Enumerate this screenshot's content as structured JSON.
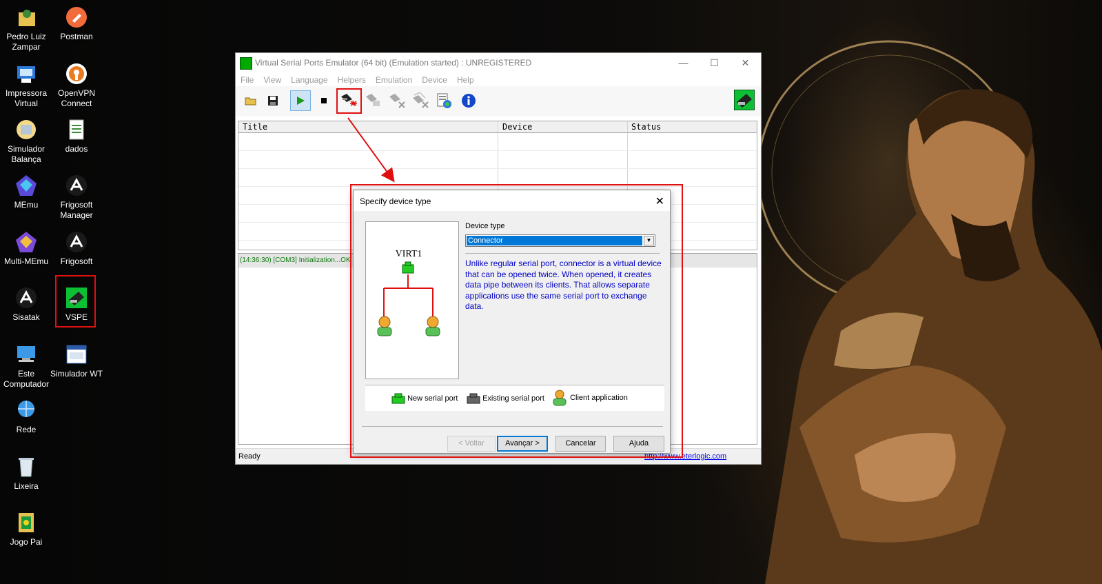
{
  "desktop": {
    "icons": [
      {
        "label": "Pedro Luiz Zampar",
        "icon": "user-folder-icon"
      },
      {
        "label": "Postman",
        "icon": "postman-icon"
      },
      {
        "label": "Impressora Virtual",
        "icon": "printer-icon"
      },
      {
        "label": "OpenVPN Connect",
        "icon": "openvpn-icon"
      },
      {
        "label": "Simulador Balança",
        "icon": "scale-simulator-icon"
      },
      {
        "label": "dados",
        "icon": "spreadsheet-file-icon"
      },
      {
        "label": "MEmu",
        "icon": "memu-icon"
      },
      {
        "label": "Frigosoft Manager",
        "icon": "frigosoft-icon"
      },
      {
        "label": "Multi-MEmu",
        "icon": "multi-memu-icon"
      },
      {
        "label": "Frigosoft",
        "icon": "frigosoft-icon"
      },
      {
        "label": "Sisatak",
        "icon": "sisatak-icon"
      },
      {
        "label": "VSPE",
        "icon": "vspe-icon"
      },
      {
        "label": "Este Computador",
        "icon": "computer-icon"
      },
      {
        "label": "Simulador WT",
        "icon": "simulator-wt-icon"
      },
      {
        "label": "Rede",
        "icon": "network-icon"
      },
      {
        "label": "Lixeira",
        "icon": "recycle-bin-icon"
      },
      {
        "label": "Jogo Pai",
        "icon": "game-folder-icon"
      }
    ]
  },
  "window": {
    "title": "Virtual Serial Ports Emulator (64 bit) (Emulation started) : UNREGISTERED",
    "controls": {
      "minimize": "—",
      "maximize": "☐",
      "close": "✕"
    }
  },
  "menu": [
    "File",
    "View",
    "Language",
    "Helpers",
    "Emulation",
    "Device",
    "Help"
  ],
  "toolbar": {
    "buttons": [
      "open-icon",
      "save-icon",
      "play-icon",
      "stop-icon",
      "create-device-icon",
      "edit-device-icon",
      "remove-device-icon",
      "remove-all-icon",
      "settings-icon",
      "info-icon"
    ]
  },
  "table": {
    "columns": [
      "Title",
      "Device",
      "Status"
    ]
  },
  "log": {
    "lines": [
      "(14:36:30) [COM3] Initialization...OK"
    ]
  },
  "statusbar": {
    "status": "Ready",
    "link": "http://www.eterlogic.com"
  },
  "dialog": {
    "title": "Specify device type",
    "diagram_label": "VIRT1",
    "device_type_label": "Device type",
    "device_type_value": "Connector",
    "description": "Unlike regular serial port, connector is a virtual device that can be opened twice. When opened, it creates data pipe between its clients. That allows separate applications use the same serial port to exchange data.",
    "legend": {
      "new_port": "New serial port",
      "existing_port": "Existing serial port",
      "client_app": "Client application"
    },
    "buttons": {
      "back": "< Voltar",
      "next": "Avançar >",
      "cancel": "Cancelar",
      "help": "Ajuda"
    }
  },
  "colors": {
    "highlight": "#e01010",
    "description_text": "#0000c8",
    "selection": "#0078d7",
    "log_text": "#0a7a0a"
  }
}
